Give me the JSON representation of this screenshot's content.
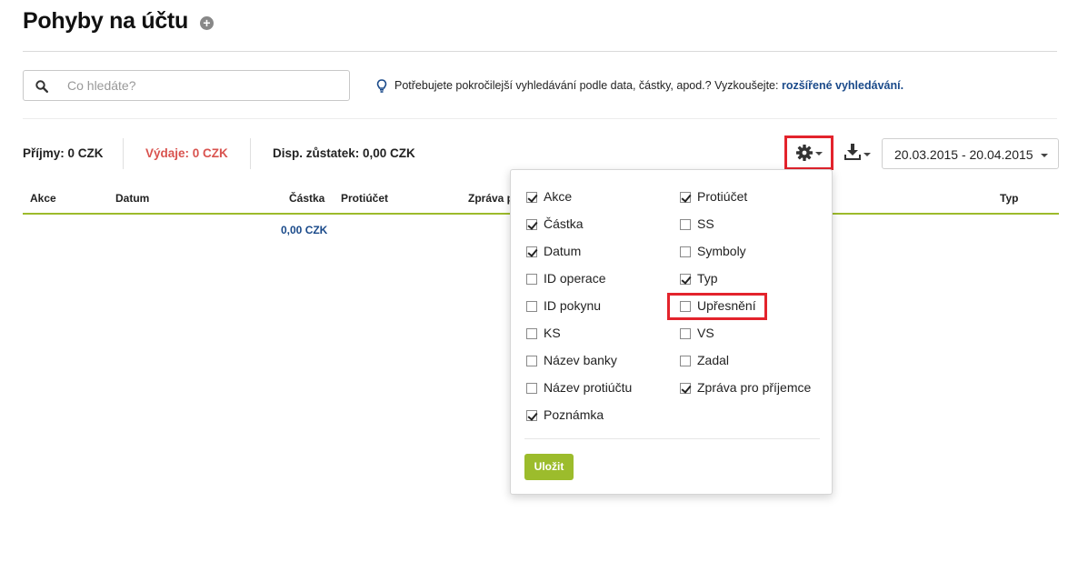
{
  "page": {
    "title": "Pohyby na účtu",
    "title_add_icon": "plus-circle-icon"
  },
  "search": {
    "placeholder": "Co hledáte?",
    "value": "",
    "icon": "search-icon"
  },
  "hint": {
    "icon": "lightbulb-icon",
    "text": "Potřebujete pokročilejší vyhledávání podle data, částky, apod.? Vyzkoušejte:",
    "link": "rozšířené vyhledávání."
  },
  "summary": {
    "income": "Příjmy: 0 CZK",
    "expenses": "Výdaje: 0 CZK",
    "balance": "Disp. zůstatek: 0,00 CZK"
  },
  "toolbar": {
    "settings_icon": "gear-icon",
    "download_icon": "download-icon",
    "date_range": "20.03.2015 - 20.04.2015"
  },
  "table": {
    "headers": [
      "Akce",
      "Datum",
      "Částka",
      "Protiúčet",
      "Zpráva p",
      "Typ"
    ],
    "total_amount": "0,00 CZK"
  },
  "column_menu": {
    "left": [
      {
        "label": "Akce",
        "checked": true
      },
      {
        "label": "Částka",
        "checked": true
      },
      {
        "label": "Datum",
        "checked": true
      },
      {
        "label": "ID operace",
        "checked": false
      },
      {
        "label": "ID pokynu",
        "checked": false
      },
      {
        "label": "KS",
        "checked": false
      },
      {
        "label": "Název banky",
        "checked": false
      },
      {
        "label": "Název protiúčtu",
        "checked": false
      },
      {
        "label": "Poznámka",
        "checked": true
      }
    ],
    "right": [
      {
        "label": "Protiúčet",
        "checked": true
      },
      {
        "label": "SS",
        "checked": false
      },
      {
        "label": "Symboly",
        "checked": false
      },
      {
        "label": "Typ",
        "checked": true
      },
      {
        "label": "Upřesnění",
        "checked": false
      },
      {
        "label": "VS",
        "checked": false
      },
      {
        "label": "Zadal",
        "checked": false
      },
      {
        "label": "Zpráva pro příjemce",
        "checked": true
      }
    ],
    "save_label": "Uložit"
  },
  "colors": {
    "accent_green": "#9cbc2c",
    "expenses_red": "#d9534f",
    "link_blue": "#1a4a8a",
    "highlight_red": "#e3232c"
  }
}
